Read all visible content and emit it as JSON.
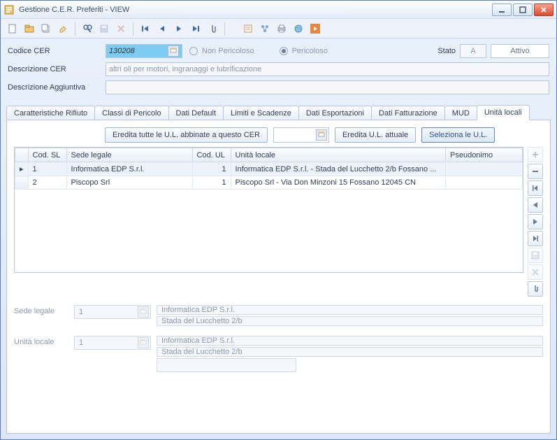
{
  "window": {
    "title": "Gestione C.E.R. Preferiti - VIEW"
  },
  "header": {
    "codice_label": "Codice CER",
    "codice_value": "130208",
    "radio_non_pericoloso": "Non Pericoloso",
    "radio_pericoloso": "Pericoloso",
    "stato_label": "Stato",
    "stato_code": "A",
    "stato_text": "Attivo",
    "descrizione_label": "Descrizione CER",
    "descrizione_value": "altri oli per motori, ingranaggi e lubrificazione",
    "descrizione_agg_label": "Descrizione Aggiuntiva",
    "descrizione_agg_value": ""
  },
  "tabs": [
    {
      "label": "Caratteristiche Rifiuto"
    },
    {
      "label": "Classi di Pericolo"
    },
    {
      "label": "Dati Default"
    },
    {
      "label": "Limiti e Scadenze"
    },
    {
      "label": "Dati Esportazioni"
    },
    {
      "label": "Dati Fatturazione"
    },
    {
      "label": "MUD"
    },
    {
      "label": "Unità locali"
    }
  ],
  "panel": {
    "btn_eredita_tutte": "Eredita tutte le U.L. abbinate a questo CER",
    "btn_eredita_attuale": "Eredita U.L. attuale",
    "btn_seleziona": "Seleziona le U.L."
  },
  "grid": {
    "cols": {
      "codsl": "Cod. SL",
      "sede": "Sede legale",
      "codul": "Cod. UL",
      "unita": "Unità locale",
      "pseudo": "Pseudonimo"
    },
    "rows": [
      {
        "codsl": "1",
        "sede": "Informatica EDP S.r.l.",
        "codul": "1",
        "unita": "Informatica EDP S.r.l. - Stada del Lucchetto 2/b Fossano ...",
        "pseudo": ""
      },
      {
        "codsl": "2",
        "sede": "Piscopo Srl",
        "codul": "1",
        "unita": "Piscopo Srl - Via Don Minzoni 15 Fossano 12045 CN",
        "pseudo": ""
      }
    ]
  },
  "detail": {
    "sede_label": "Sede legale",
    "sede_code": "1",
    "sede_name": "Informatica EDP S.r.l.",
    "sede_addr": "Stada del Lucchetto 2/b",
    "unita_label": "Unità locale",
    "unita_code": "1",
    "unita_name": "Informatica EDP S.r.l.",
    "unita_addr": "Stada del Lucchetto 2/b",
    "unita_extra": ""
  }
}
